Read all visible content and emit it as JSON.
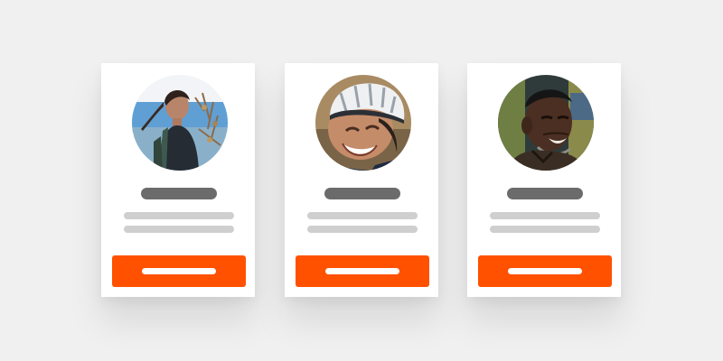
{
  "colors": {
    "background": "#f0f0f0",
    "card": "#ffffff",
    "accent": "#ff5100",
    "name_placeholder": "#6b6b6b",
    "text_placeholder": "#cfcfcf",
    "button_placeholder": "#ffffff"
  },
  "cards": [
    {
      "avatar": "woman-hiking-photo",
      "name_placeholder": "",
      "text_placeholder_lines": 2,
      "button_placeholder": ""
    },
    {
      "avatar": "cyclist-helmet-photo",
      "name_placeholder": "",
      "text_placeholder_lines": 2,
      "button_placeholder": ""
    },
    {
      "avatar": "smiling-man-photo",
      "name_placeholder": "",
      "text_placeholder_lines": 2,
      "button_placeholder": ""
    }
  ]
}
